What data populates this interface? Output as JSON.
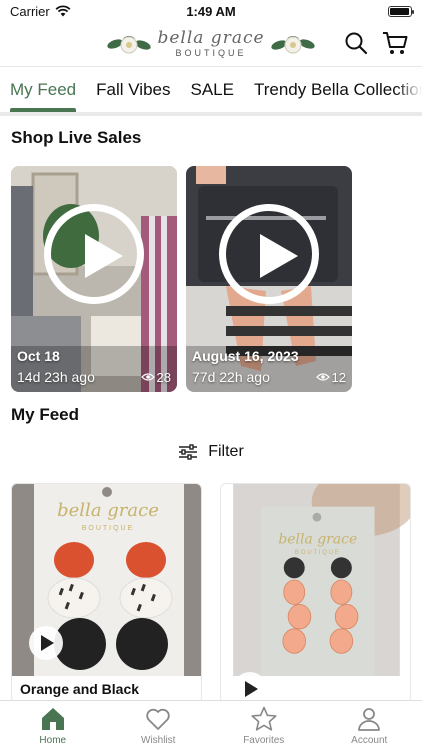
{
  "status": {
    "carrier": "Carrier",
    "time": "1:49 AM",
    "battery_level": 0.95
  },
  "header": {
    "logo_script": "bella grace",
    "logo_sub": "BOUTIQUE",
    "actions": [
      {
        "icon": "search-icon"
      },
      {
        "icon": "cart-icon"
      }
    ]
  },
  "tabs": [
    {
      "label": "My Feed",
      "active": true
    },
    {
      "label": "Fall Vibes",
      "active": false
    },
    {
      "label": "SALE",
      "active": false
    },
    {
      "label": "Trendy Bella Collection",
      "active": false
    }
  ],
  "live_sales": {
    "title": "Shop Live Sales",
    "items": [
      {
        "date": "Oct 18",
        "ago": "14d 23h ago",
        "views": "28"
      },
      {
        "date": "August 16, 2023",
        "ago": "77d 22h ago",
        "views": "12"
      }
    ]
  },
  "feed": {
    "title": "My Feed",
    "filter_label": "Filter",
    "items": [
      {
        "title": "Orange and Black",
        "card_logo": "bella grace",
        "card_sub": "BOUTIQUE"
      },
      {
        "title": "",
        "card_logo": "bella grace",
        "card_sub": "BOUTIQUE"
      }
    ]
  },
  "bottom_nav": [
    {
      "label": "Home",
      "icon": "home-icon",
      "active": true
    },
    {
      "label": "Wishlist",
      "icon": "heart-icon",
      "active": false
    },
    {
      "label": "Favorites",
      "icon": "star-icon",
      "active": false
    },
    {
      "label": "Account",
      "icon": "person-icon",
      "active": false
    }
  ],
  "colors": {
    "accent": "#4a7552",
    "tab_rule": "#e9e9e9"
  }
}
